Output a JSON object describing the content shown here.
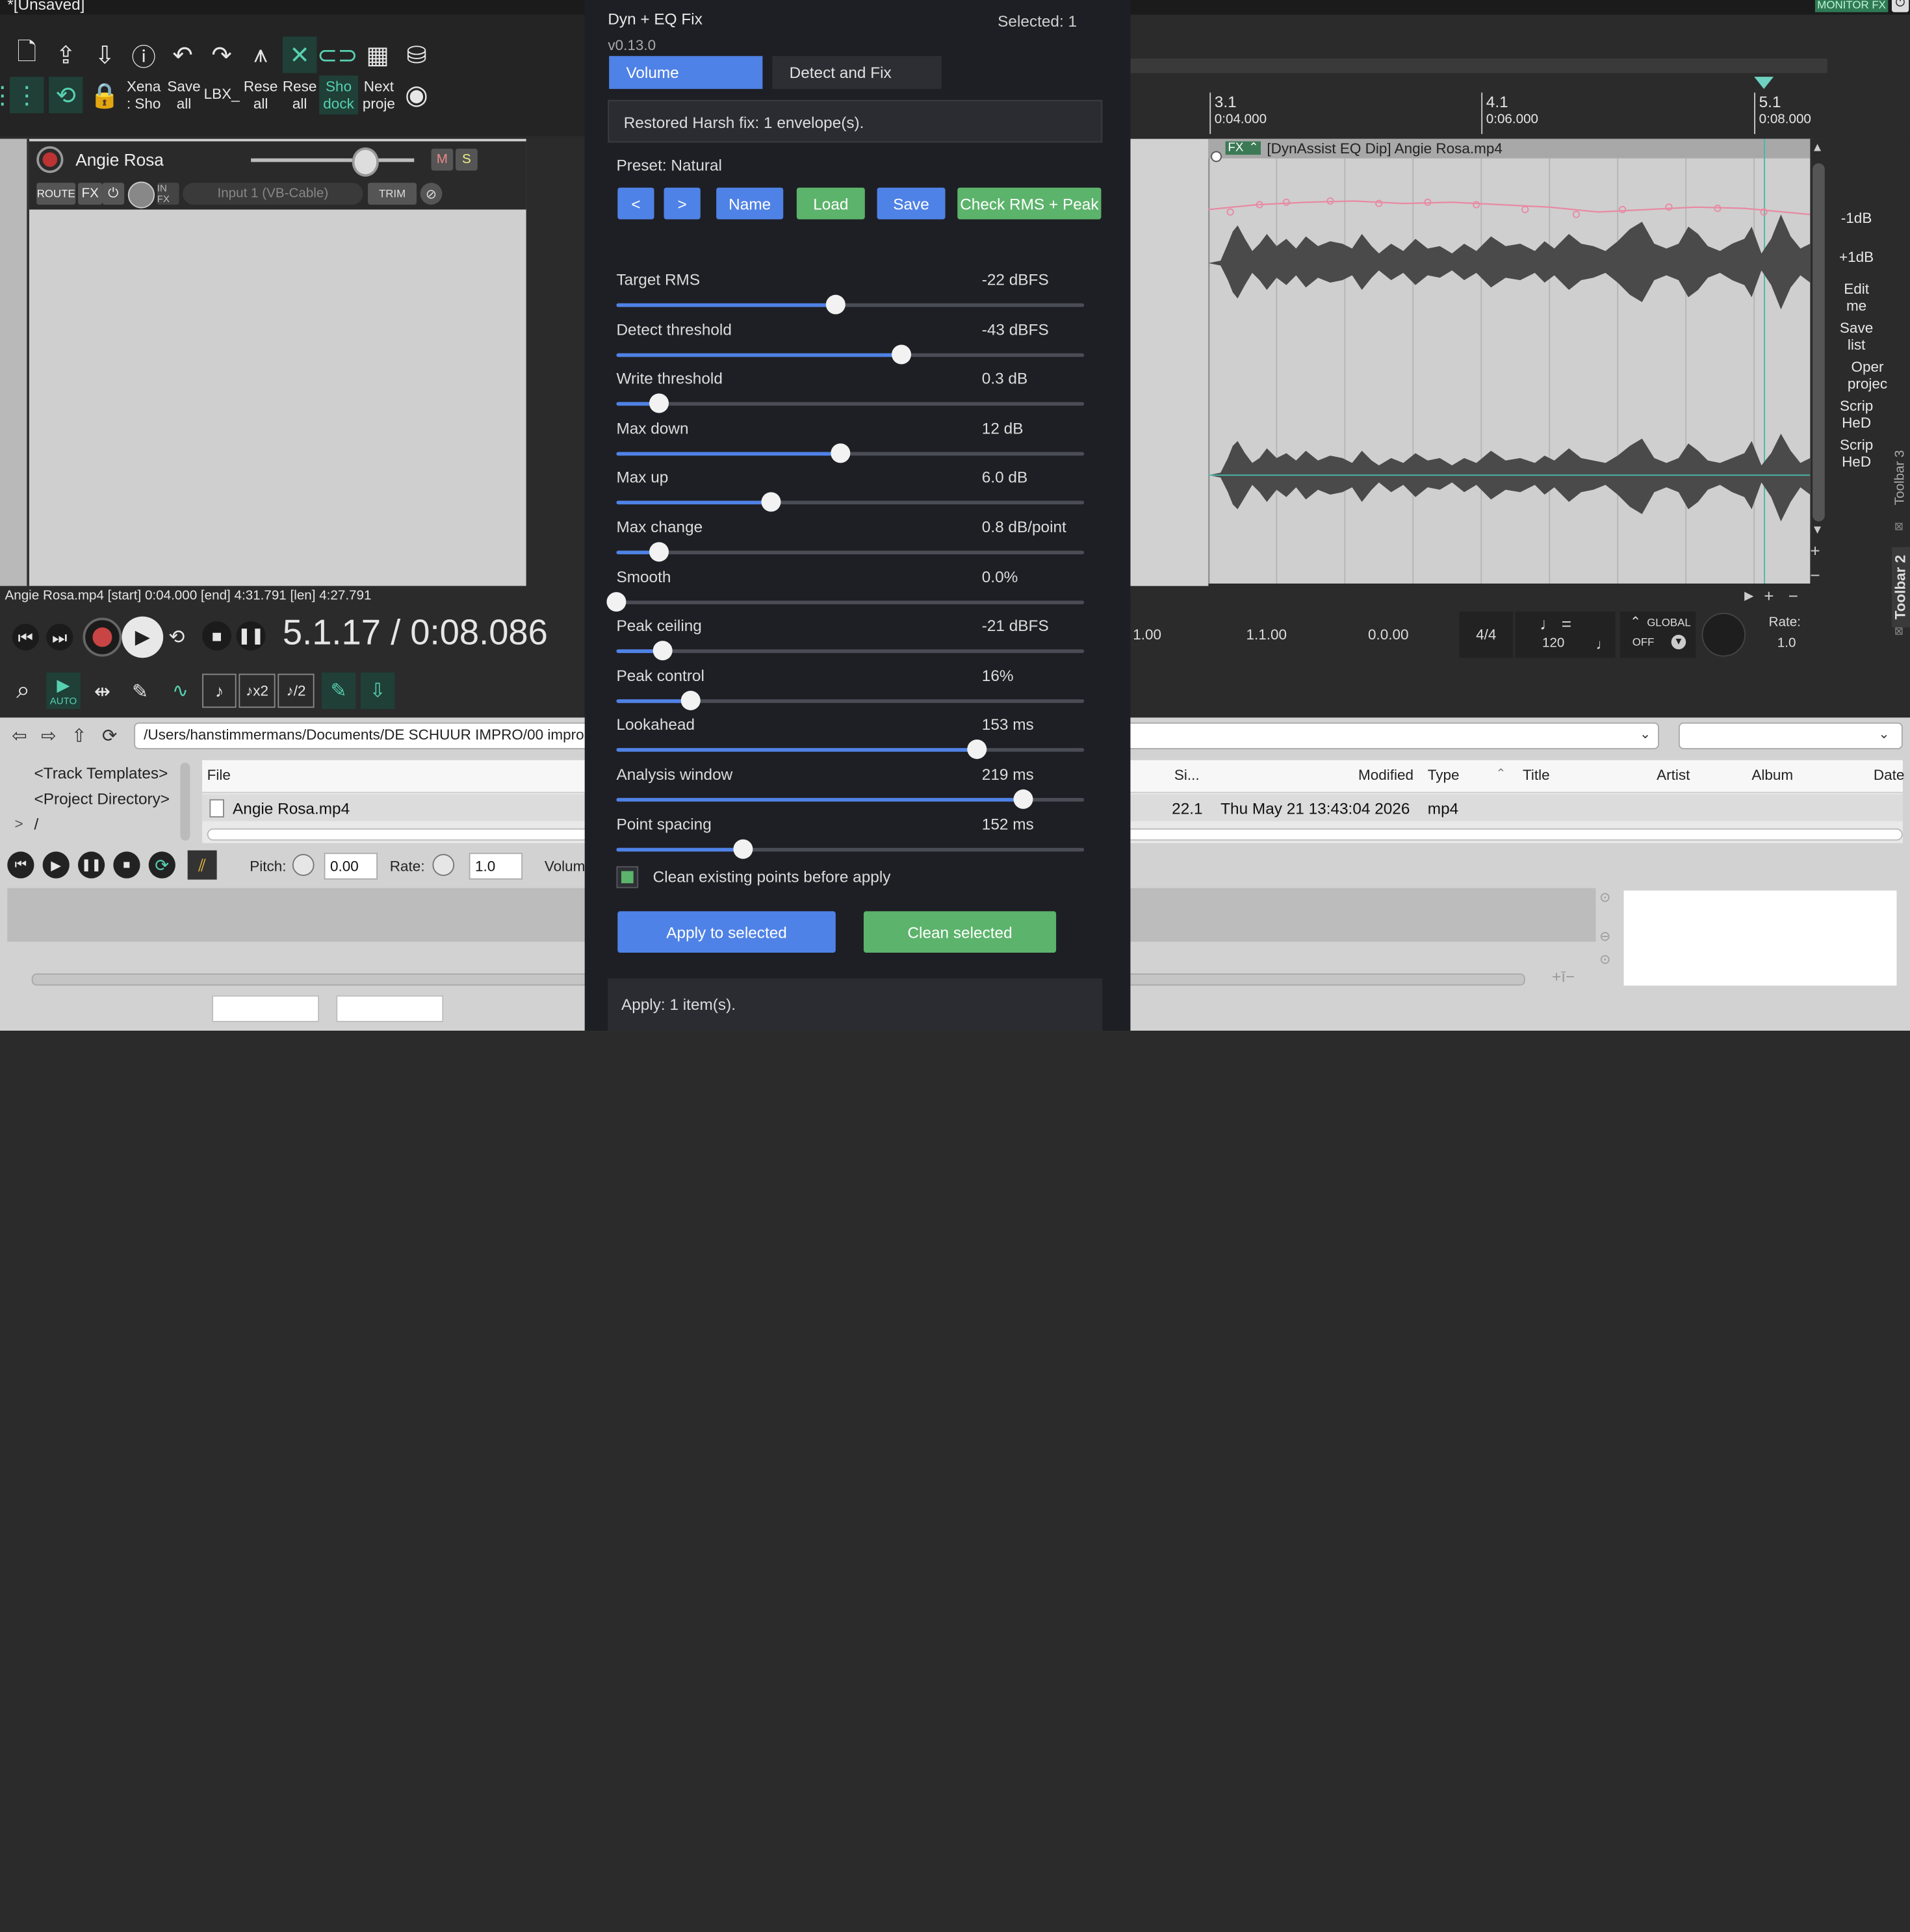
{
  "window": {
    "title": "*[Unsaved]",
    "monitor_fx": "MONITOR FX"
  },
  "toolbar": {
    "labels": [
      {
        "key": "xena",
        "text": "Xena\n: Sho"
      },
      {
        "key": "save_all",
        "text": "Save\nall"
      },
      {
        "key": "lbx",
        "text": "LBX_"
      },
      {
        "key": "reset_all_1",
        "text": "Rese\nall"
      },
      {
        "key": "reset_all_2",
        "text": "Rese\nall"
      },
      {
        "key": "show_dock",
        "text": "Sho\ndock"
      },
      {
        "key": "next_project",
        "text": "Next\nproje"
      }
    ]
  },
  "track": {
    "name": "Angie Rosa",
    "mute": "M",
    "solo": "S",
    "route": "ROUTE",
    "fx": "FX",
    "input": "Input 1 (VB-Cable)",
    "trim": "TRIM"
  },
  "item_info": "Angie Rosa.mp4 [start] 0:04.000 [end] 4:31.791 [len] 4:27.791",
  "transport": {
    "time": "5.1.17 / 0:08.086",
    "auto": "AUTO"
  },
  "ruler": [
    {
      "bar": "3.1",
      "time": "0:04.000"
    },
    {
      "bar": "4.1",
      "time": "0:06.000"
    },
    {
      "bar": "5.1",
      "time": "0:08.000"
    }
  ],
  "media_item": {
    "fx_badge": "FX",
    "title": "[DynAssist EQ Dip] Angie Rosa.mp4"
  },
  "right_toolbar": [
    {
      "key": "minus1db",
      "text": "-1dB"
    },
    {
      "key": "plus1db",
      "text": "+1dB"
    },
    {
      "key": "edit_me",
      "text": "Edit\nme"
    },
    {
      "key": "save_list",
      "text": "Save\nlist"
    },
    {
      "key": "open_proj",
      "text": "Oper\nprojec"
    },
    {
      "key": "script_1",
      "text": "Scrip\nHeD"
    },
    {
      "key": "script_2",
      "text": "Scrip\nHeD"
    }
  ],
  "docker_tabs": {
    "toolbar3": "Toolbar 3",
    "toolbar2": "Toolbar 2"
  },
  "status_bar": {
    "sel_start": "1.00",
    "sel_end": "1.1.00",
    "length": "0.0.00",
    "timesig": "4/4",
    "bpm": "120",
    "global": "GLOBAL",
    "off": "OFF",
    "rate_label": "Rate:",
    "rate_value": "1.0"
  },
  "browser": {
    "path": "/Users/hanstimmermans/Documents/DE SCHUUR IMPRO/00 impro loss",
    "tree": [
      "<Track Templates>",
      "<Project Directory>",
      "/"
    ],
    "tree_arrow": ">",
    "columns": {
      "file": "File",
      "size": "Si...",
      "modified": "Modified",
      "type": "Type",
      "title": "Title",
      "artist": "Artist",
      "album": "Album",
      "date": "Date"
    },
    "row": {
      "file": "Angie Rosa.mp4",
      "size": "22.1",
      "modified": "Thu May 21 13:43:04 2026",
      "type": "mp4"
    },
    "pitch_label": "Pitch:",
    "pitch_value": "0.00",
    "rate_label": "Rate:",
    "rate_value": "1.0",
    "volume_label": "Volum"
  },
  "panel": {
    "title": "Dyn + EQ Fix",
    "selected": "Selected: 1",
    "version": "v0.13.0",
    "tabs": [
      {
        "key": "volume",
        "label": "Volume",
        "active": true
      },
      {
        "key": "detect",
        "label": "Detect and Fix",
        "active": false
      }
    ],
    "message": "Restored Harsh fix: 1 envelope(s).",
    "preset": "Preset: Natural",
    "preset_buttons": {
      "prev": "<",
      "next": ">",
      "name": "Name",
      "load": "Load",
      "save": "Save",
      "check": "Check RMS + Peak"
    },
    "sliders": [
      {
        "key": "target_rms",
        "label": "Target RMS",
        "value": "-22 dBFS",
        "level": 0.47
      },
      {
        "key": "detect_threshold",
        "label": "Detect threshold",
        "value": "-43 dBFS",
        "level": 0.61
      },
      {
        "key": "write_threshold",
        "label": "Write threshold",
        "value": "0.3 dB",
        "level": 0.09
      },
      {
        "key": "max_down",
        "label": "Max down",
        "value": "12 dB",
        "level": 0.48
      },
      {
        "key": "max_up",
        "label": "Max up",
        "value": "6.0 dB",
        "level": 0.33
      },
      {
        "key": "max_change",
        "label": "Max change",
        "value": "0.8 dB/point",
        "level": 0.09
      },
      {
        "key": "smooth",
        "label": "Smooth",
        "value": "0.0%",
        "level": 0.0
      },
      {
        "key": "peak_ceiling",
        "label": "Peak ceiling",
        "value": "-21 dBFS",
        "level": 0.1
      },
      {
        "key": "peak_control",
        "label": "Peak control",
        "value": "16%",
        "level": 0.16
      },
      {
        "key": "lookahead",
        "label": "Lookahead",
        "value": "153 ms",
        "level": 0.77
      },
      {
        "key": "analysis_window",
        "label": "Analysis window",
        "value": "219 ms",
        "level": 0.87
      },
      {
        "key": "point_spacing",
        "label": "Point spacing",
        "value": "152 ms",
        "level": 0.27
      }
    ],
    "checkbox": {
      "label": "Clean existing points before apply",
      "checked": true
    },
    "apply_button": "Apply to selected",
    "clean_button": "Clean selected",
    "footer": "Apply: 1 item(s)."
  },
  "colors": {
    "accent_blue": "#4f82e6",
    "accent_green": "#5cb36b",
    "panel_bg": "#1e1f24",
    "toolbar_teal": "#57d0b0"
  }
}
